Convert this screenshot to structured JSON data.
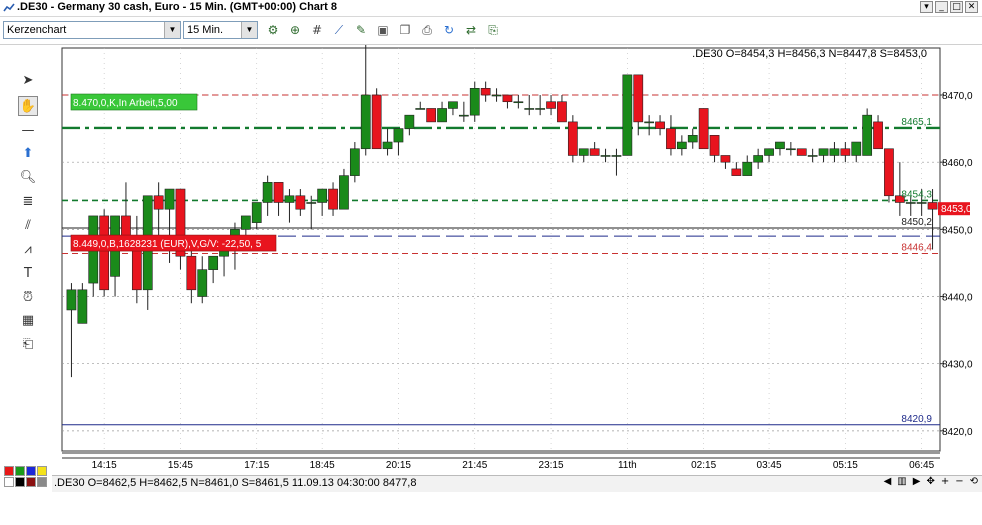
{
  "window": {
    "title": ".DE30 - Germany 30 cash, Euro - 15 Min. (GMT+00:00)    Chart 8"
  },
  "toolbar": {
    "chart_type": "Kerzenchart",
    "timeframe": "15 Min."
  },
  "status": {
    "text": ".DE30 O=8462,5 H=8462,5 N=8461,0 S=8461,5    11.09.13 04:30:00 8477,8"
  },
  "colors": {
    "bull": "#1a8a1a",
    "bear": "#e8141e",
    "background": "#ffffff"
  },
  "chart_data": {
    "type": "candlestick",
    "info": ".DE30 O=8454,3 H=8456,3 N=8447,8 S=8453,0",
    "ylim": [
      8417,
      8477
    ],
    "y_ticks": [
      "8470,0",
      "8460,0",
      "8450,0",
      "8440,0",
      "8430,0",
      "8420,0"
    ],
    "x_ticks": [
      "14:15",
      "15:45",
      "17:15",
      "18:45",
      "20:15",
      "21:45",
      "23:15",
      "11th",
      "02:15",
      "03:45",
      "05:15",
      "06:45"
    ],
    "grid": true,
    "candles": [
      {
        "o": 8438,
        "h": 8442,
        "l": 8428,
        "c": 8441
      },
      {
        "o": 8436,
        "h": 8442,
        "l": 8436,
        "c": 8441
      },
      {
        "o": 8442,
        "h": 8452,
        "l": 8440,
        "c": 8452
      },
      {
        "o": 8452,
        "h": 8453,
        "l": 8440,
        "c": 8441
      },
      {
        "o": 8443,
        "h": 8452,
        "l": 8440,
        "c": 8452
      },
      {
        "o": 8452,
        "h": 8457,
        "l": 8447,
        "c": 8449
      },
      {
        "o": 8449,
        "h": 8452,
        "l": 8439,
        "c": 8441
      },
      {
        "o": 8441,
        "h": 8455,
        "l": 8438,
        "c": 8455
      },
      {
        "o": 8455,
        "h": 8457,
        "l": 8449,
        "c": 8453
      },
      {
        "o": 8453,
        "h": 8456,
        "l": 8445,
        "c": 8456
      },
      {
        "o": 8456,
        "h": 8456,
        "l": 8444,
        "c": 8446
      },
      {
        "o": 8446,
        "h": 8448,
        "l": 8439,
        "c": 8441
      },
      {
        "o": 8440,
        "h": 8446,
        "l": 8439,
        "c": 8444
      },
      {
        "o": 8444,
        "h": 8446,
        "l": 8442,
        "c": 8446
      },
      {
        "o": 8446,
        "h": 8448,
        "l": 8443,
        "c": 8448
      },
      {
        "o": 8448,
        "h": 8451,
        "l": 8444,
        "c": 8450
      },
      {
        "o": 8450,
        "h": 8452,
        "l": 8449,
        "c": 8452
      },
      {
        "o": 8451,
        "h": 8454,
        "l": 8450,
        "c": 8454
      },
      {
        "o": 8454,
        "h": 8458,
        "l": 8452,
        "c": 8457
      },
      {
        "o": 8457,
        "h": 8457,
        "l": 8452,
        "c": 8454
      },
      {
        "o": 8454,
        "h": 8456,
        "l": 8451,
        "c": 8455
      },
      {
        "o": 8455,
        "h": 8456,
        "l": 8452,
        "c": 8453
      },
      {
        "o": 8454,
        "h": 8455,
        "l": 8450,
        "c": 8454
      },
      {
        "o": 8454,
        "h": 8456,
        "l": 8452,
        "c": 8456
      },
      {
        "o": 8456,
        "h": 8457,
        "l": 8452,
        "c": 8453
      },
      {
        "o": 8453,
        "h": 8459,
        "l": 8453,
        "c": 8458
      },
      {
        "o": 8458,
        "h": 8463,
        "l": 8457,
        "c": 8462
      },
      {
        "o": 8462,
        "h": 8478,
        "l": 8461,
        "c": 8470
      },
      {
        "o": 8470,
        "h": 8471,
        "l": 8462,
        "c": 8462
      },
      {
        "o": 8462,
        "h": 8465,
        "l": 8461,
        "c": 8463
      },
      {
        "o": 8463,
        "h": 8465,
        "l": 8461,
        "c": 8465
      },
      {
        "o": 8465,
        "h": 8467,
        "l": 8464,
        "c": 8467
      },
      {
        "o": 8468,
        "h": 8469,
        "l": 8468,
        "c": 8468
      },
      {
        "o": 8468,
        "h": 8468,
        "l": 8466,
        "c": 8466
      },
      {
        "o": 8466,
        "h": 8469,
        "l": 8466,
        "c": 8468
      },
      {
        "o": 8468,
        "h": 8469,
        "l": 8467,
        "c": 8469
      },
      {
        "o": 8467,
        "h": 8469,
        "l": 8466,
        "c": 8467
      },
      {
        "o": 8467,
        "h": 8472,
        "l": 8466,
        "c": 8471
      },
      {
        "o": 8471,
        "h": 8472,
        "l": 8469,
        "c": 8470
      },
      {
        "o": 8470,
        "h": 8471,
        "l": 8469,
        "c": 8470
      },
      {
        "o": 8470,
        "h": 8470,
        "l": 8468,
        "c": 8469
      },
      {
        "o": 8469,
        "h": 8470,
        "l": 8468,
        "c": 8469
      },
      {
        "o": 8468,
        "h": 8470,
        "l": 8467,
        "c": 8468
      },
      {
        "o": 8468,
        "h": 8470,
        "l": 8467,
        "c": 8468
      },
      {
        "o": 8469,
        "h": 8470,
        "l": 8467,
        "c": 8468
      },
      {
        "o": 8469,
        "h": 8470,
        "l": 8467,
        "c": 8466
      },
      {
        "o": 8466,
        "h": 8467,
        "l": 8460,
        "c": 8461
      },
      {
        "o": 8461,
        "h": 8462,
        "l": 8460,
        "c": 8462
      },
      {
        "o": 8462,
        "h": 8463,
        "l": 8461,
        "c": 8461
      },
      {
        "o": 8461,
        "h": 8462,
        "l": 8460,
        "c": 8461
      },
      {
        "o": 8461,
        "h": 8462,
        "l": 8458,
        "c": 8461
      },
      {
        "o": 8461,
        "h": 8473,
        "l": 8461,
        "c": 8473
      },
      {
        "o": 8473,
        "h": 8473,
        "l": 8464,
        "c": 8466
      },
      {
        "o": 8466,
        "h": 8467,
        "l": 8464,
        "c": 8466
      },
      {
        "o": 8466,
        "h": 8467,
        "l": 8464,
        "c": 8465
      },
      {
        "o": 8465,
        "h": 8467,
        "l": 8461,
        "c": 8462
      },
      {
        "o": 8462,
        "h": 8464,
        "l": 8461,
        "c": 8463
      },
      {
        "o": 8463,
        "h": 8465,
        "l": 8462,
        "c": 8464
      },
      {
        "o": 8468,
        "h": 8468,
        "l": 8462,
        "c": 8462
      },
      {
        "o": 8464,
        "h": 8464,
        "l": 8460,
        "c": 8461
      },
      {
        "o": 8461,
        "h": 8461,
        "l": 8459,
        "c": 8460
      },
      {
        "o": 8459,
        "h": 8460,
        "l": 8458,
        "c": 8458
      },
      {
        "o": 8458,
        "h": 8461,
        "l": 8458,
        "c": 8460
      },
      {
        "o": 8460,
        "h": 8462,
        "l": 8459,
        "c": 8461
      },
      {
        "o": 8461,
        "h": 8462,
        "l": 8460,
        "c": 8462
      },
      {
        "o": 8462,
        "h": 8463,
        "l": 8461,
        "c": 8463
      },
      {
        "o": 8462,
        "h": 8463,
        "l": 8461,
        "c": 8462
      },
      {
        "o": 8462,
        "h": 8462,
        "l": 8461,
        "c": 8461
      },
      {
        "o": 8461,
        "h": 8462,
        "l": 8460,
        "c": 8461
      },
      {
        "o": 8461,
        "h": 8462,
        "l": 8460,
        "c": 8462
      },
      {
        "o": 8461,
        "h": 8463,
        "l": 8460,
        "c": 8462
      },
      {
        "o": 8462,
        "h": 8463,
        "l": 8460,
        "c": 8461
      },
      {
        "o": 8461,
        "h": 8463,
        "l": 8460,
        "c": 8463
      },
      {
        "o": 8461,
        "h": 8468,
        "l": 8461,
        "c": 8467
      },
      {
        "o": 8466,
        "h": 8467,
        "l": 8462,
        "c": 8462
      },
      {
        "o": 8462,
        "h": 8462,
        "l": 8454,
        "c": 8455
      },
      {
        "o": 8455,
        "h": 8460,
        "l": 8452,
        "c": 8454
      },
      {
        "o": 8454,
        "h": 8455,
        "l": 8452,
        "c": 8454
      },
      {
        "o": 8454,
        "h": 8456,
        "l": 8452,
        "c": 8454
      },
      {
        "o": 8454,
        "h": 8456,
        "l": 8447,
        "c": 8453
      }
    ],
    "lines": [
      {
        "name": "order-line",
        "y": 8470.0,
        "color": "#c83232",
        "style": "dashed"
      },
      {
        "name": "resistance-line",
        "y": 8465.1,
        "color": "#127a2e",
        "style": "dashdot",
        "label": "8465,1"
      },
      {
        "name": "support-line",
        "y": 8454.3,
        "color": "#127a2e",
        "style": "dashed",
        "label": "8454,3"
      },
      {
        "name": "current-price-line",
        "y": 8450.2,
        "color": "#222222",
        "style": "solid",
        "label": "8450,2"
      },
      {
        "name": "position-line",
        "y": 8449.0,
        "color": "#1e2a8a",
        "style": "longdash"
      },
      {
        "name": "stop-line",
        "y": 8446.4,
        "color": "#c83232",
        "style": "dashed",
        "label": "8446,4"
      },
      {
        "name": "bottom-line",
        "y": 8420.9,
        "color": "#1e2a8a",
        "style": "solid",
        "label": "8420,9"
      }
    ],
    "current_price": {
      "value": 8453.0,
      "label": "8453,0"
    },
    "order_label": "8.470,0,K,In Arbeit,5,00",
    "position_label": "8.449,0,B,1628231 (EUR),V,G/V: -22,50, 5"
  }
}
